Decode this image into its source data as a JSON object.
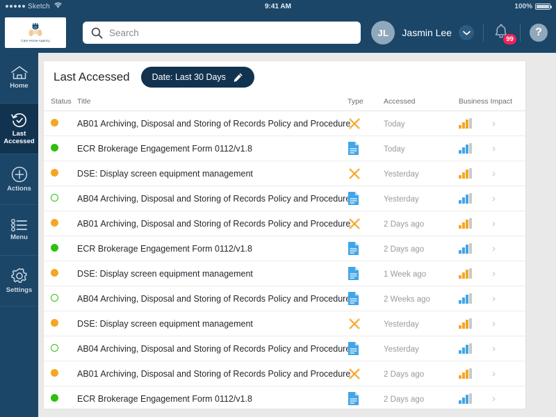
{
  "status_bar": {
    "carrier": "Sketch",
    "time": "9:41 AM",
    "battery": "100%"
  },
  "header": {
    "logo_text": "Care Home Agency",
    "search_placeholder": "Search",
    "search_value": "",
    "avatar_initials": "JL",
    "user_name": "Jasmin Lee",
    "notification_count": "99"
  },
  "sidebar": {
    "items": [
      {
        "label": "Home",
        "icon": "home-icon",
        "active": false
      },
      {
        "label": "Last Accessed",
        "icon": "history-clock-icon",
        "active": true
      },
      {
        "label": "Actions",
        "icon": "plus-circle-icon",
        "active": false
      },
      {
        "label": "Menu",
        "icon": "list-menu-icon",
        "active": false
      },
      {
        "label": "Settings",
        "icon": "gear-icon",
        "active": false
      }
    ]
  },
  "main": {
    "title": "Last Accessed",
    "date_filter": "Date: Last 30 Days",
    "columns": [
      "Status",
      "Title",
      "Type",
      "Accessed",
      "Business Impact"
    ],
    "rows": [
      {
        "status": "orange",
        "title": "AB01 Archiving, Disposal and Storing of Records Policy and Procedure",
        "type": "tools-icon",
        "accessed": "Today",
        "impact": "orange"
      },
      {
        "status": "green",
        "title": "ECR Brokerage Engagement Form 0112/v1.8",
        "type": "document-icon",
        "accessed": "Today",
        "impact": "blue"
      },
      {
        "status": "orange",
        "title": "DSE: Display screen equipment management",
        "type": "tools-icon",
        "accessed": "Yesterday",
        "impact": "orange"
      },
      {
        "status": "hollow",
        "title": "AB04 Archiving, Disposal and Storing of Records Policy and Procedure",
        "type": "document-icon",
        "accessed": "Yesterday",
        "impact": "blue"
      },
      {
        "status": "orange",
        "title": "AB01 Archiving, Disposal and Storing of Records Policy and Procedure",
        "type": "tools-icon",
        "accessed": "2 Days ago",
        "impact": "orange"
      },
      {
        "status": "green",
        "title": "ECR Brokerage Engagement Form 0112/v1.8",
        "type": "document-icon",
        "accessed": "2 Days ago",
        "impact": "blue"
      },
      {
        "status": "orange",
        "title": "DSE: Display screen equipment management",
        "type": "document-icon",
        "accessed": "1 Week ago",
        "impact": "orange"
      },
      {
        "status": "hollow",
        "title": "AB04 Archiving, Disposal and Storing of Records Policy and Procedure",
        "type": "document-icon",
        "accessed": "2 Weeks ago",
        "impact": "blue"
      },
      {
        "status": "orange",
        "title": "DSE: Display screen equipment management",
        "type": "tools-icon",
        "accessed": "Yesterday",
        "impact": "orange"
      },
      {
        "status": "hollow",
        "title": "AB04 Archiving, Disposal and Storing of Records Policy and Procedure",
        "type": "document-icon",
        "accessed": "Yesterday",
        "impact": "blue"
      },
      {
        "status": "orange",
        "title": "AB01 Archiving, Disposal and Storing of Records Policy and Procedure",
        "type": "tools-icon",
        "accessed": "2 Days ago",
        "impact": "orange"
      },
      {
        "status": "green",
        "title": "ECR Brokerage Engagement Form 0112/v1.8",
        "type": "document-icon",
        "accessed": "2 Days ago",
        "impact": "blue"
      }
    ]
  },
  "colors": {
    "brand_navy": "#1B4668",
    "active_navy": "#123350",
    "orange": "#F5A623",
    "green": "#2DC00E",
    "blue": "#42A5E8",
    "badge_pink": "#F0235B"
  }
}
